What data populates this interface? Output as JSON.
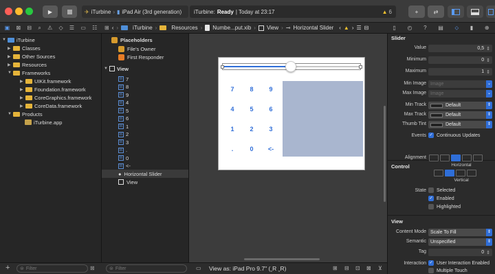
{
  "toolbar": {
    "scheme_target": "iTurbine",
    "scheme_device": "iPad Air (3rd generation)",
    "status_app": "iTurbine:",
    "status_state": "Ready",
    "status_time": "| Today at 23:17",
    "warning_count": "6",
    "accent": "#2f6ed8"
  },
  "navigator": {
    "project": "iTurbine",
    "items": [
      "Classes",
      "Other Sources",
      "Resources",
      "Frameworks",
      "UIKit.framework",
      "Foundation.framework",
      "CoreGraphics.framework",
      "CoreData.framework",
      "Products",
      "iTurbine.app"
    ],
    "filter_placeholder": "Filter"
  },
  "jumpbar": {
    "crumbs": [
      "iTurbine",
      "Resources",
      "Numbe...put.xib",
      "View",
      "Horizontal Slider"
    ]
  },
  "outline": {
    "placeholders": "Placeholders",
    "files_owner": "File's Owner",
    "first_responder": "First Responder",
    "view": "View",
    "buttons": [
      "7",
      "8",
      "9",
      "4",
      "5",
      "6",
      "1",
      "2",
      "3",
      ".",
      "0",
      "<-"
    ],
    "slider": "Horizontal Slider",
    "subview": "View",
    "filter_placeholder": "Filter"
  },
  "canvas": {
    "keys": [
      "7",
      "8",
      "9",
      "4",
      "5",
      "6",
      "1",
      "2",
      "3",
      ".",
      "0",
      "<-"
    ],
    "view_as": "View as: iPad Pro 9.7\" (ˬR ˬR)"
  },
  "inspector": {
    "slider_header": "Slider",
    "value_label": "Value",
    "value": "0,5",
    "min_label": "Minimum",
    "min": "0",
    "max_label": "Maximum",
    "max": "1",
    "min_image_label": "Min Image",
    "min_image_ph": "Image",
    "max_image_label": "Max Image",
    "max_image_ph": "Image",
    "min_track_label": "Min Track",
    "min_track": "Default",
    "max_track_label": "Max Track",
    "max_track": "Default",
    "thumb_tint_label": "Thumb Tint",
    "thumb_tint": "Default",
    "events_label": "Events",
    "events_value": "Continuous Updates",
    "control_header": "Control",
    "alignment_label": "Alignment",
    "horizontal": "Horizontal",
    "vertical": "Vertical",
    "state_label": "State",
    "state_selected": "Selected",
    "state_enabled": "Enabled",
    "state_highlighted": "Highlighted",
    "view_header": "View",
    "content_mode_label": "Content Mode",
    "content_mode": "Scale To Fill",
    "semantic_label": "Semantic",
    "semantic": "Unspecified",
    "tag_label": "Tag",
    "tag": "0",
    "interaction_label": "Interaction",
    "interaction_user": "User Interaction Enabled",
    "interaction_multi": "Multiple Touch"
  }
}
